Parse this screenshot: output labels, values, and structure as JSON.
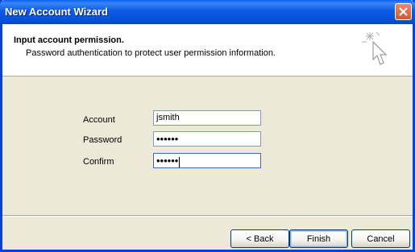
{
  "window": {
    "title": "New Account Wizard"
  },
  "header": {
    "title": "Input account permission.",
    "subtitle": "Password authentication to protect user permission information."
  },
  "form": {
    "account_label": "Account",
    "account_value": "jsmith",
    "password_label": "Password",
    "password_value": "••••••",
    "confirm_label": "Confirm",
    "confirm_value": "••••••"
  },
  "buttons": {
    "back": "< Back",
    "finish": "Finish",
    "cancel": "Cancel"
  },
  "colors": {
    "titlebar": "#0a5ef0",
    "close": "#d9552c",
    "dialog_bg": "#ece9d8"
  }
}
